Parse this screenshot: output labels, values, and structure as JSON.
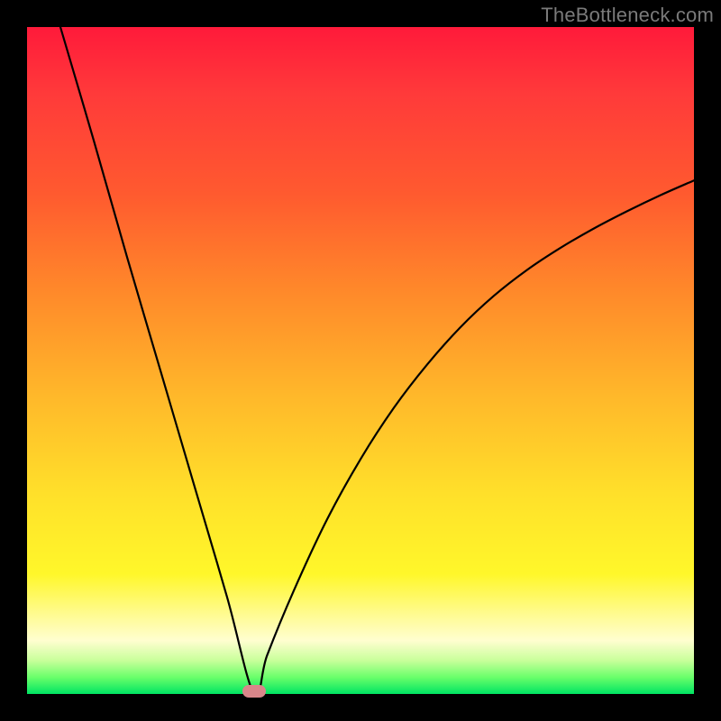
{
  "watermark": "TheBottleneck.com",
  "chart_data": {
    "type": "line",
    "title": "",
    "xlabel": "",
    "ylabel": "",
    "xlim": [
      0,
      1
    ],
    "ylim": [
      0,
      1
    ],
    "series": [
      {
        "name": "curve",
        "x": [
          0.05,
          0.1,
          0.15,
          0.2,
          0.25,
          0.3,
          0.3405,
          0.36,
          0.4,
          0.45,
          0.5,
          0.55,
          0.6,
          0.65,
          0.7,
          0.75,
          0.8,
          0.85,
          0.9,
          0.95,
          1.0
        ],
        "y": [
          1.0,
          0.83,
          0.655,
          0.485,
          0.315,
          0.145,
          0.0,
          0.058,
          0.155,
          0.262,
          0.352,
          0.429,
          0.494,
          0.55,
          0.597,
          0.636,
          0.669,
          0.698,
          0.724,
          0.748,
          0.77
        ]
      }
    ],
    "marker": {
      "x": 0.3405,
      "y": 0.0
    },
    "background_gradient": {
      "top": "#ff1a3a",
      "mid": "#ffe02a",
      "bottom": "#00e463"
    }
  }
}
